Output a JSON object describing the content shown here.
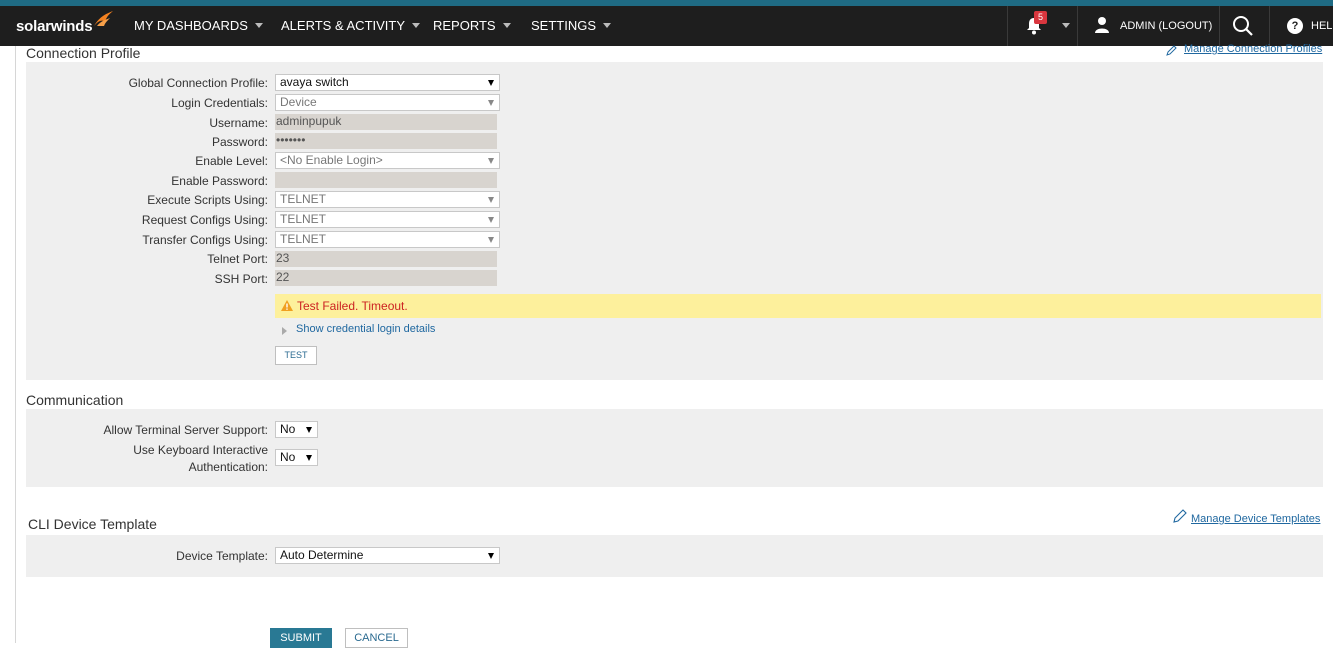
{
  "nav": {
    "logo": "solarwinds",
    "items": [
      {
        "label": "MY DASHBOARDS"
      },
      {
        "label": "ALERTS & ACTIVITY"
      },
      {
        "label": "REPORTS"
      },
      {
        "label": "SETTINGS"
      }
    ],
    "notification_count": "5",
    "user_label": "ADMIN (LOGOUT)",
    "help_label": "HELP"
  },
  "connection_profile": {
    "title": "Connection Profile",
    "manage_link": "Manage Connection Profiles",
    "fields": {
      "global_profile": {
        "label": "Global Connection Profile:",
        "value": "avaya switch"
      },
      "login_credentials": {
        "label": "Login Credentials:",
        "value": "Device"
      },
      "username": {
        "label": "Username:",
        "value": "adminpupuk"
      },
      "password": {
        "label": "Password:",
        "value": "•••••••"
      },
      "enable_level": {
        "label": "Enable Level:",
        "value": "<No Enable Login>"
      },
      "enable_password": {
        "label": "Enable Password:",
        "value": ""
      },
      "execute_scripts": {
        "label": "Execute Scripts Using:",
        "value": "TELNET"
      },
      "request_configs": {
        "label": "Request Configs Using:",
        "value": "TELNET"
      },
      "transfer_configs": {
        "label": "Transfer Configs Using:",
        "value": "TELNET"
      },
      "telnet_port": {
        "label": "Telnet Port:",
        "value": "23"
      },
      "ssh_port": {
        "label": "SSH Port:",
        "value": "22"
      }
    },
    "warning": "Test Failed. Timeout.",
    "show_details": "Show credential login details",
    "test_button": "TEST"
  },
  "communication": {
    "title": "Communication",
    "terminal_server": {
      "label": "Allow Terminal Server Support:",
      "value": "No"
    },
    "keyboard_auth": {
      "label_line1": "Use Keyboard Interactive",
      "label_line2": "Authentication:",
      "value": "No"
    }
  },
  "cli_template": {
    "title": "CLI Device Template",
    "manage_link": "Manage Device Templates",
    "device_template": {
      "label": "Device Template:",
      "value": "Auto Determine"
    }
  },
  "actions": {
    "submit": "SUBMIT",
    "cancel": "CANCEL"
  },
  "colors": {
    "navbar": "#1e1e1e",
    "accent": "#1f6b84",
    "panel": "#efefef",
    "warning_bg": "#fdf09c",
    "warning_text": "#cc2222",
    "link": "#2068a0",
    "primary_button": "#297994"
  }
}
